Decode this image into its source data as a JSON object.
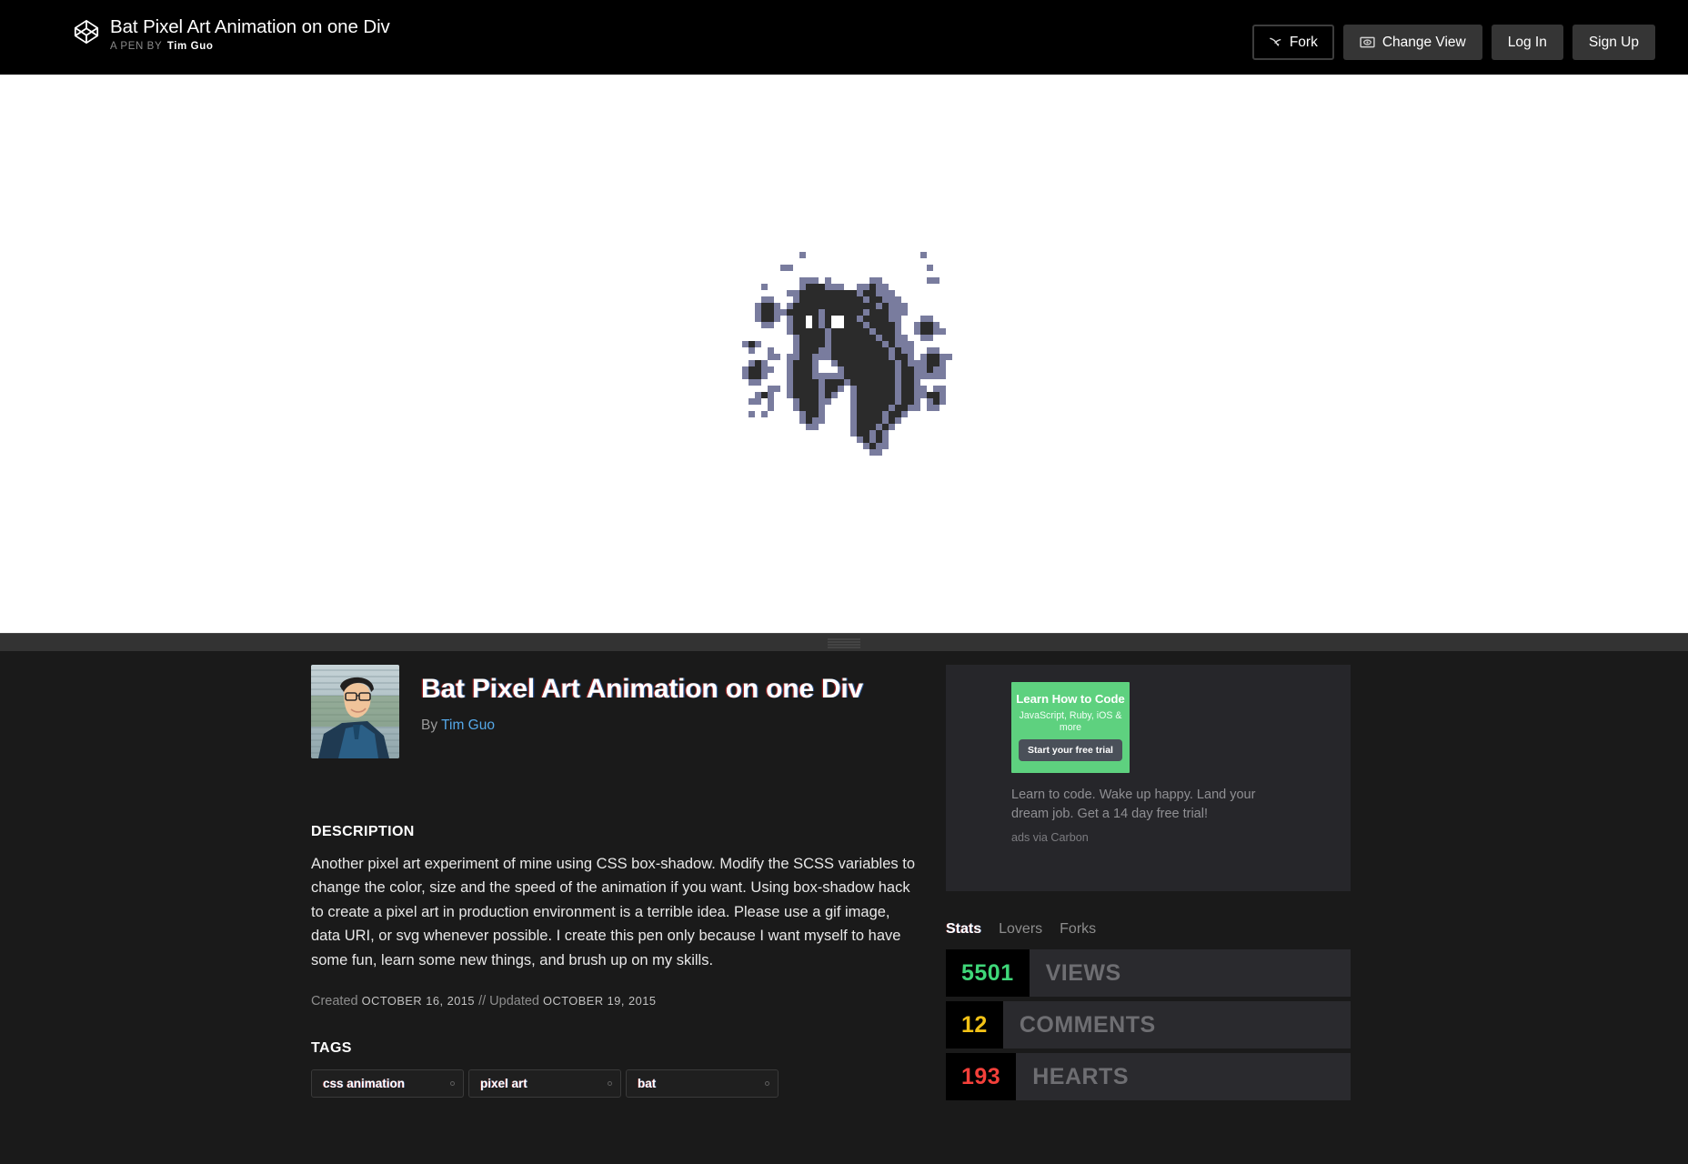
{
  "header": {
    "logo_icon": "codepen-logo-icon",
    "title": "Bat Pixel Art Animation on one Div",
    "byline_prefix": "A PEN BY",
    "byline_author": "Tim Guo",
    "buttons": [
      {
        "label": "Fork",
        "icon": "fork-icon",
        "style": "ghost"
      },
      {
        "label": "Change View",
        "icon": "change-view-icon",
        "style": "solid"
      },
      {
        "label": "Log In",
        "icon": "",
        "style": "solid"
      },
      {
        "label": "Sign Up",
        "icon": "",
        "style": "solid"
      }
    ]
  },
  "preview": {
    "background": "#ffffff",
    "art_name": "bat-pixel-art",
    "dark_color": "#2b2b2b",
    "edge_color": "#797c9e"
  },
  "resize": {
    "handle_name": "preview-resize-handle"
  },
  "details": {
    "avatar_alt": "Tim Guo avatar",
    "pen_title": "Bat Pixel Art Animation on one Div",
    "by_prefix": "By",
    "author": "Tim Guo",
    "description_heading": "DESCRIPTION",
    "description_body": "Another pixel art experiment of mine using CSS box-shadow. Modify the SCSS variables to change the color, size and the speed of the animation if you want. Using box-shadow hack to create a pixel art in production environment is a terrible idea. Please use a gif image, data URI, or svg whenever possible. I create this pen only because I want myself to have some fun, learn some new things, and brush up on my skills.",
    "created_label": "Created",
    "created_date": "OCTOBER 16, 2015",
    "date_separator": "//",
    "updated_label": "Updated",
    "updated_date": "OCTOBER 19, 2015",
    "tags_heading": "TAGS",
    "tags": [
      {
        "label": "css animation"
      },
      {
        "label": "pixel art"
      },
      {
        "label": "bat"
      }
    ]
  },
  "ad": {
    "headline": "Learn How to Code",
    "sub": "JavaScript, Ruby, iOS\n& more",
    "cta": "Start your free trial",
    "copy": "Learn to code. Wake up happy. Land your dream job. Get a 14 day free trial!",
    "via": "ads via Carbon",
    "brand_color": "#5ed17f"
  },
  "stats": {
    "tabs": [
      {
        "label": "Stats",
        "active": true
      },
      {
        "label": "Lovers",
        "active": false
      },
      {
        "label": "Forks",
        "active": false
      }
    ],
    "rows": [
      {
        "value": "5501",
        "label": "VIEWS",
        "color": "#3fd779"
      },
      {
        "value": "12",
        "label": "COMMENTS",
        "color": "#f2c216"
      },
      {
        "value": "193",
        "label": "HEARTS",
        "color": "#f4403a"
      }
    ]
  }
}
